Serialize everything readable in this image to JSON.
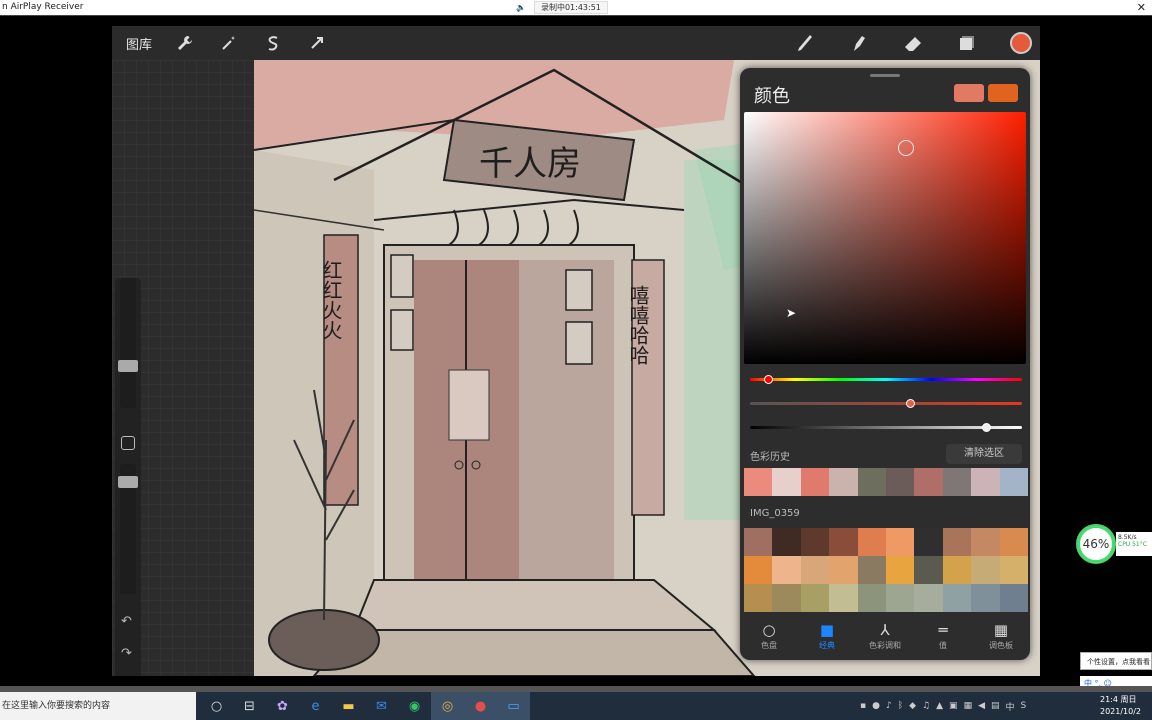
{
  "window": {
    "title": "n AirPlay Receiver",
    "recording": "录制中01:43:51",
    "close": "✕"
  },
  "procreate": {
    "gallery": "图库",
    "panel_title": "颜色",
    "history_label": "色彩历史",
    "clear_label": "清除选区",
    "palette_label": "IMG_0359",
    "current_color": "#e27a63",
    "previous_color": "#e0631f",
    "history_colors": [
      "#ec8a7d",
      "#e7cfcb",
      "#e07a6c",
      "#c9b3ac",
      "#6e6e5e",
      "#6b5c5a",
      "#b06e68",
      "#7e7775",
      "#cbb3b8",
      "#a3b4c8"
    ],
    "palette_colors": [
      "#a06f62",
      "#3f2a24",
      "#5e3a2c",
      "#8a4d3a",
      "#e07d4f",
      "#ef9a64",
      "#2f2f30",
      "#a9745a",
      "#c48963",
      "#d88a4f",
      "#e38a3b",
      "#eeb48c",
      "#d8a779",
      "#e2a46c",
      "#8a7a62",
      "#e8a43e",
      "#5a5a4e",
      "#d4a24b",
      "#c7ab76",
      "#d5b06a",
      "#b48f4f",
      "#9c8a5c",
      "#a79f63",
      "#c2bd93",
      "#8d947c",
      "#9ca691",
      "#a7ad9c",
      "#8fa1a2",
      "#80909a",
      "#707f90"
    ],
    "tabs": [
      {
        "label": "色盘",
        "icon": "○"
      },
      {
        "label": "经典",
        "icon": "■"
      },
      {
        "label": "色彩调和",
        "icon": "⅄"
      },
      {
        "label": "值",
        "icon": "═"
      },
      {
        "label": "调色板",
        "icon": "▦"
      }
    ],
    "signs": {
      "shop_name": "千人房",
      "couplet_left": "红红火火",
      "couplet_right": "嘻嘻哈哈"
    }
  },
  "desktop": {
    "monitor_percent": "46%",
    "net_speed": "8.5K/s",
    "cpu": "CPU 51°C",
    "tip": "个性设置，点我看看",
    "ime": "中 °, ☺",
    "search_placeholder": "在这里输入你要搜索的内容",
    "clock_time": "21:4",
    "clock_day": "周日",
    "clock_date": "2021/10/2"
  }
}
